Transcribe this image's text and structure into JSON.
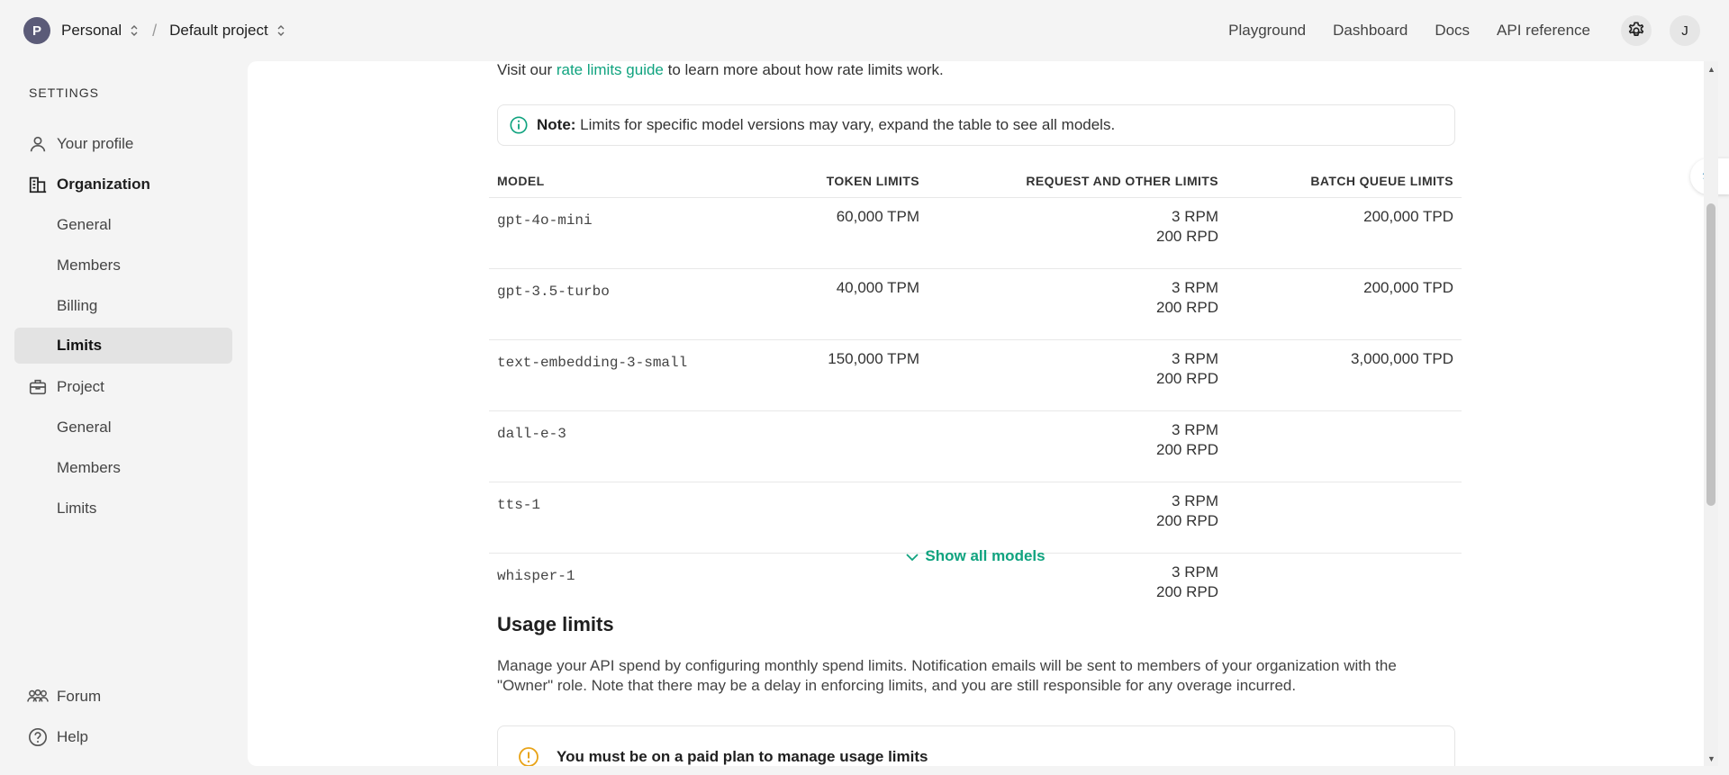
{
  "header": {
    "org_initial": "P",
    "org_name": "Personal",
    "separator": "/",
    "project_name": "Default project",
    "nav": [
      "Playground",
      "Dashboard",
      "Docs",
      "API reference"
    ],
    "user_initial": "J"
  },
  "sidebar": {
    "heading": "SETTINGS",
    "your_profile": "Your profile",
    "organization": "Organization",
    "org_items": [
      "General",
      "Members",
      "Billing",
      "Limits"
    ],
    "project": "Project",
    "project_items": [
      "General",
      "Members",
      "Limits"
    ],
    "forum": "Forum",
    "help": "Help"
  },
  "main": {
    "visit_prefix": "Visit our ",
    "visit_link": "rate limits guide",
    "visit_suffix": " to learn more about how rate limits work.",
    "note_label": "Note:",
    "note_text": " Limits for specific model versions may vary, expand the table to see all models.",
    "table": {
      "headers": [
        "MODEL",
        "TOKEN LIMITS",
        "REQUEST AND OTHER LIMITS",
        "BATCH QUEUE LIMITS"
      ],
      "rows": [
        {
          "model": "gpt-4o-mini",
          "token": "60,000 TPM",
          "rpm": "3 RPM",
          "rpd": "200 RPD",
          "batch": "200,000 TPD"
        },
        {
          "model": "gpt-3.5-turbo",
          "token": "40,000 TPM",
          "rpm": "3 RPM",
          "rpd": "200 RPD",
          "batch": "200,000 TPD"
        },
        {
          "model": "text-embedding-3-small",
          "token": "150,000 TPM",
          "rpm": "3 RPM",
          "rpd": "200 RPD",
          "batch": "3,000,000 TPD"
        },
        {
          "model": "dall-e-3",
          "token": "",
          "rpm": "3 RPM",
          "rpd": "200 RPD",
          "batch": ""
        },
        {
          "model": "tts-1",
          "token": "",
          "rpm": "3 RPM",
          "rpd": "200 RPD",
          "batch": ""
        },
        {
          "model": "whisper-1",
          "token": "",
          "rpm": "3 RPM",
          "rpd": "200 RPD",
          "batch": ""
        }
      ]
    },
    "show_all": "Show all models",
    "usage_heading": "Usage limits",
    "usage_text": "Manage your API spend by configuring monthly spend limits. Notification emails will be sent to members of your organization with the \"Owner\" role. Note that there may be a delay in enforcing limits, and you are still responsible for any overage incurred.",
    "warning_text": "You must be on a paid plan to manage usage limits"
  },
  "colors": {
    "accent": "#10a37f",
    "warning": "#e8a317",
    "avatar": "#5b5b78"
  },
  "icons": {
    "gear": "gear-icon",
    "info": "info-icon",
    "warning": "warning-icon",
    "person": "person-icon",
    "building": "building-icon",
    "briefcase": "briefcase-icon",
    "people": "people-icon",
    "help": "help-icon",
    "chevron": "chevron-down-icon"
  }
}
